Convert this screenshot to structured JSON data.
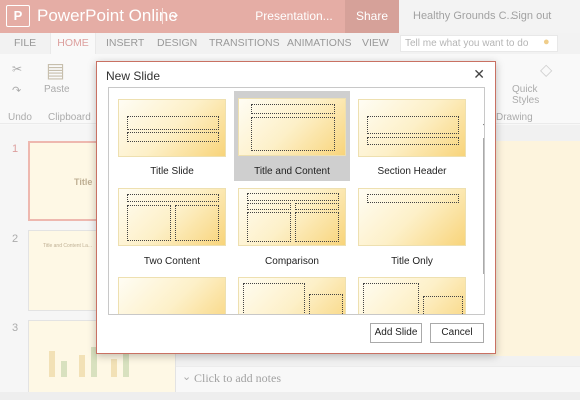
{
  "titlebar": {
    "logo_letter": "P",
    "app_name": "PowerPoint Online",
    "file_title": "Presentation...",
    "share_label": "Share",
    "account_name": "Healthy Grounds C...",
    "signout_label": "Sign out",
    "bg_color": "#cf6b5c"
  },
  "ribbon": {
    "tabs": [
      "FILE",
      "HOME",
      "INSERT",
      "DESIGN",
      "TRANSITIONS",
      "ANIMATIONS",
      "VIEW"
    ],
    "active_tab": "HOME",
    "tell_me_placeholder": "Tell me what you want to do",
    "paste_label": "Paste",
    "undo_label": "Undo",
    "clipboard_label": "Clipboard",
    "quick_styles_label": "Quick Styles",
    "drawing_label": "Drawing"
  },
  "thumbnails": {
    "numbers": [
      "1",
      "2",
      "3"
    ],
    "thumb1_title": "Title",
    "thumb2_title": "Title and Content La..."
  },
  "notes": {
    "placeholder": "Click to add notes"
  },
  "dialog": {
    "title": "New Slide",
    "close_icon": "close-icon",
    "layouts": [
      {
        "label": "Title Slide",
        "selected": false
      },
      {
        "label": "Title and Content",
        "selected": true
      },
      {
        "label": "Section Header",
        "selected": false
      },
      {
        "label": "Two Content",
        "selected": false
      },
      {
        "label": "Comparison",
        "selected": false
      },
      {
        "label": "Title Only",
        "selected": false
      },
      {
        "label": "",
        "selected": false
      },
      {
        "label": "",
        "selected": false
      },
      {
        "label": "",
        "selected": false
      }
    ],
    "add_slide_label": "Add Slide",
    "cancel_label": "Cancel"
  }
}
